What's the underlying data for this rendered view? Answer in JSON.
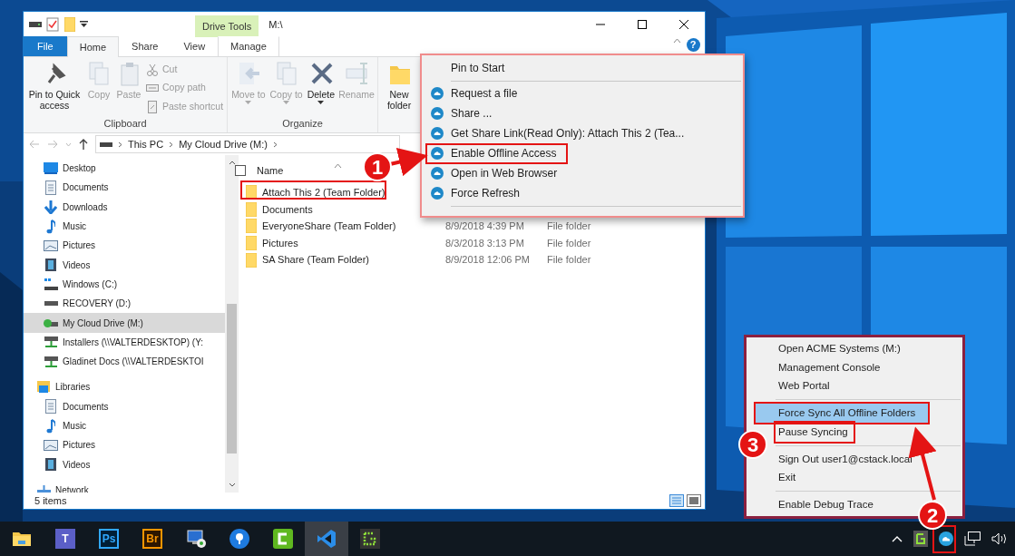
{
  "explorer": {
    "contextual_tab_group": "Drive Tools",
    "title": "M:\\",
    "help_glyph": "?",
    "ribbon_tabs": [
      {
        "label": "File",
        "kind": "file",
        "selected": false
      },
      {
        "label": "Home",
        "kind": "tab",
        "selected": true
      },
      {
        "label": "Share",
        "kind": "tab",
        "selected": false
      },
      {
        "label": "View",
        "kind": "tab",
        "selected": false
      },
      {
        "label": "Manage",
        "kind": "contextual",
        "selected": false
      }
    ],
    "ribbon_groups": [
      {
        "label": "Clipboard",
        "buttons": [
          {
            "label": "Pin to Quick access",
            "kind": "large",
            "disabled": false
          },
          {
            "label": "Copy",
            "kind": "large",
            "disabled": true
          },
          {
            "label": "Paste",
            "kind": "large",
            "disabled": true
          },
          {
            "label": "Cut",
            "kind": "small",
            "disabled": true
          },
          {
            "label": "Copy path",
            "kind": "small",
            "disabled": true
          },
          {
            "label": "Paste shortcut",
            "kind": "small",
            "disabled": true
          }
        ]
      },
      {
        "label": "Organize",
        "buttons": [
          {
            "label": "Move to",
            "kind": "large",
            "disabled": true,
            "dropdown": true
          },
          {
            "label": "Copy to",
            "kind": "large",
            "disabled": true,
            "dropdown": true
          },
          {
            "label": "Delete",
            "kind": "large",
            "disabled": false,
            "dropdown": true
          },
          {
            "label": "Rename",
            "kind": "large",
            "disabled": true
          }
        ]
      },
      {
        "buttons": [
          {
            "label": "New folder",
            "kind": "large",
            "disabled": false
          }
        ]
      }
    ],
    "address": [
      "This PC",
      "My Cloud Drive (M:)"
    ],
    "navigation": [
      {
        "label": "Desktop",
        "kind": "desktop",
        "selected": false
      },
      {
        "label": "Documents",
        "kind": "documents",
        "selected": false
      },
      {
        "label": "Downloads",
        "kind": "downloads",
        "selected": false
      },
      {
        "label": "Music",
        "kind": "music",
        "selected": false
      },
      {
        "label": "Pictures",
        "kind": "pictures",
        "selected": false
      },
      {
        "label": "Videos",
        "kind": "videos",
        "selected": false
      },
      {
        "label": "Windows (C:)",
        "kind": "system",
        "selected": false
      },
      {
        "label": "RECOVERY (D:)",
        "kind": "drive",
        "selected": false
      },
      {
        "label": "My Cloud Drive (M:)",
        "kind": "cloud",
        "selected": true
      },
      {
        "label": "Installers (\\\\VALTERDESKTOP) (Y:",
        "kind": "share",
        "selected": false
      },
      {
        "label": "Gladinet Docs (\\\\VALTERDESKTOI",
        "kind": "share",
        "selected": false
      },
      {
        "label": "Libraries",
        "kind": "library",
        "selected": false,
        "children": [
          {
            "label": "Documents",
            "kind": "documents",
            "selected": false
          },
          {
            "label": "Music",
            "kind": "music",
            "selected": false
          },
          {
            "label": "Pictures",
            "kind": "pictures",
            "selected": false
          },
          {
            "label": "Videos",
            "kind": "videos",
            "selected": false
          }
        ]
      },
      {
        "label": "Network",
        "kind": "network",
        "selected": false
      }
    ],
    "select_all_checked": false,
    "columns": [
      "Name"
    ],
    "files": [
      {
        "name": "Attach This 2 (Team Folder)"
      },
      {
        "name": "Documents"
      },
      {
        "name": "EveryoneShare (Team Folder)",
        "date": "8/9/2018 4:39 PM",
        "type": "File folder"
      },
      {
        "name": "Pictures",
        "date": "8/3/2018 3:13 PM",
        "type": "File folder"
      },
      {
        "name": "SA Share (Team Folder)",
        "date": "8/9/2018 12:06 PM",
        "type": "File folder"
      }
    ],
    "status": "5 items"
  },
  "context_menu": [
    {
      "label": "Pin to Start",
      "kind": "plain"
    },
    {
      "kind": "separator"
    },
    {
      "label": "Request a file",
      "kind": "cloud"
    },
    {
      "label": "Share ...",
      "kind": "cloud"
    },
    {
      "label": "Get Share Link(Read Only): Attach This 2 (Tea...",
      "kind": "cloud"
    },
    {
      "label": "Enable Offline Access",
      "kind": "cloud"
    },
    {
      "label": "Open in Web Browser",
      "kind": "cloud"
    },
    {
      "label": "Force Refresh",
      "kind": "cloud"
    },
    {
      "kind": "separator"
    }
  ],
  "tray_menu": [
    {
      "label": "Open ACME Systems (M:)",
      "kind": "item",
      "selected": false,
      "highlighted": false
    },
    {
      "label": "Management Console",
      "kind": "item",
      "selected": false,
      "highlighted": false
    },
    {
      "label": "Web Portal",
      "kind": "item",
      "selected": false,
      "highlighted": false
    },
    {
      "kind": "separator"
    },
    {
      "label": "Force Sync All Offline Folders",
      "kind": "item",
      "selected": true,
      "highlighted": true
    },
    {
      "label": "Pause Syncing",
      "kind": "item",
      "selected": false,
      "highlighted": true
    },
    {
      "kind": "separator"
    },
    {
      "label": "Sign Out user1@cstack.local",
      "kind": "item",
      "selected": false,
      "highlighted": false
    },
    {
      "label": "Exit",
      "kind": "item",
      "selected": false,
      "highlighted": false
    },
    {
      "kind": "separator"
    },
    {
      "label": "Enable Debug Trace",
      "kind": "item",
      "selected": false,
      "highlighted": false
    }
  ],
  "callouts": [
    "1",
    "2",
    "3"
  ],
  "taskbar": [
    {
      "active": false
    },
    {
      "glyph": "T",
      "active": false
    },
    {
      "glyph": "Ps",
      "active": false
    },
    {
      "glyph": "Br",
      "active": false
    },
    {
      "active": false
    },
    {
      "active": false
    },
    {
      "active": false
    },
    {
      "active": true
    },
    {
      "active": false
    }
  ]
}
